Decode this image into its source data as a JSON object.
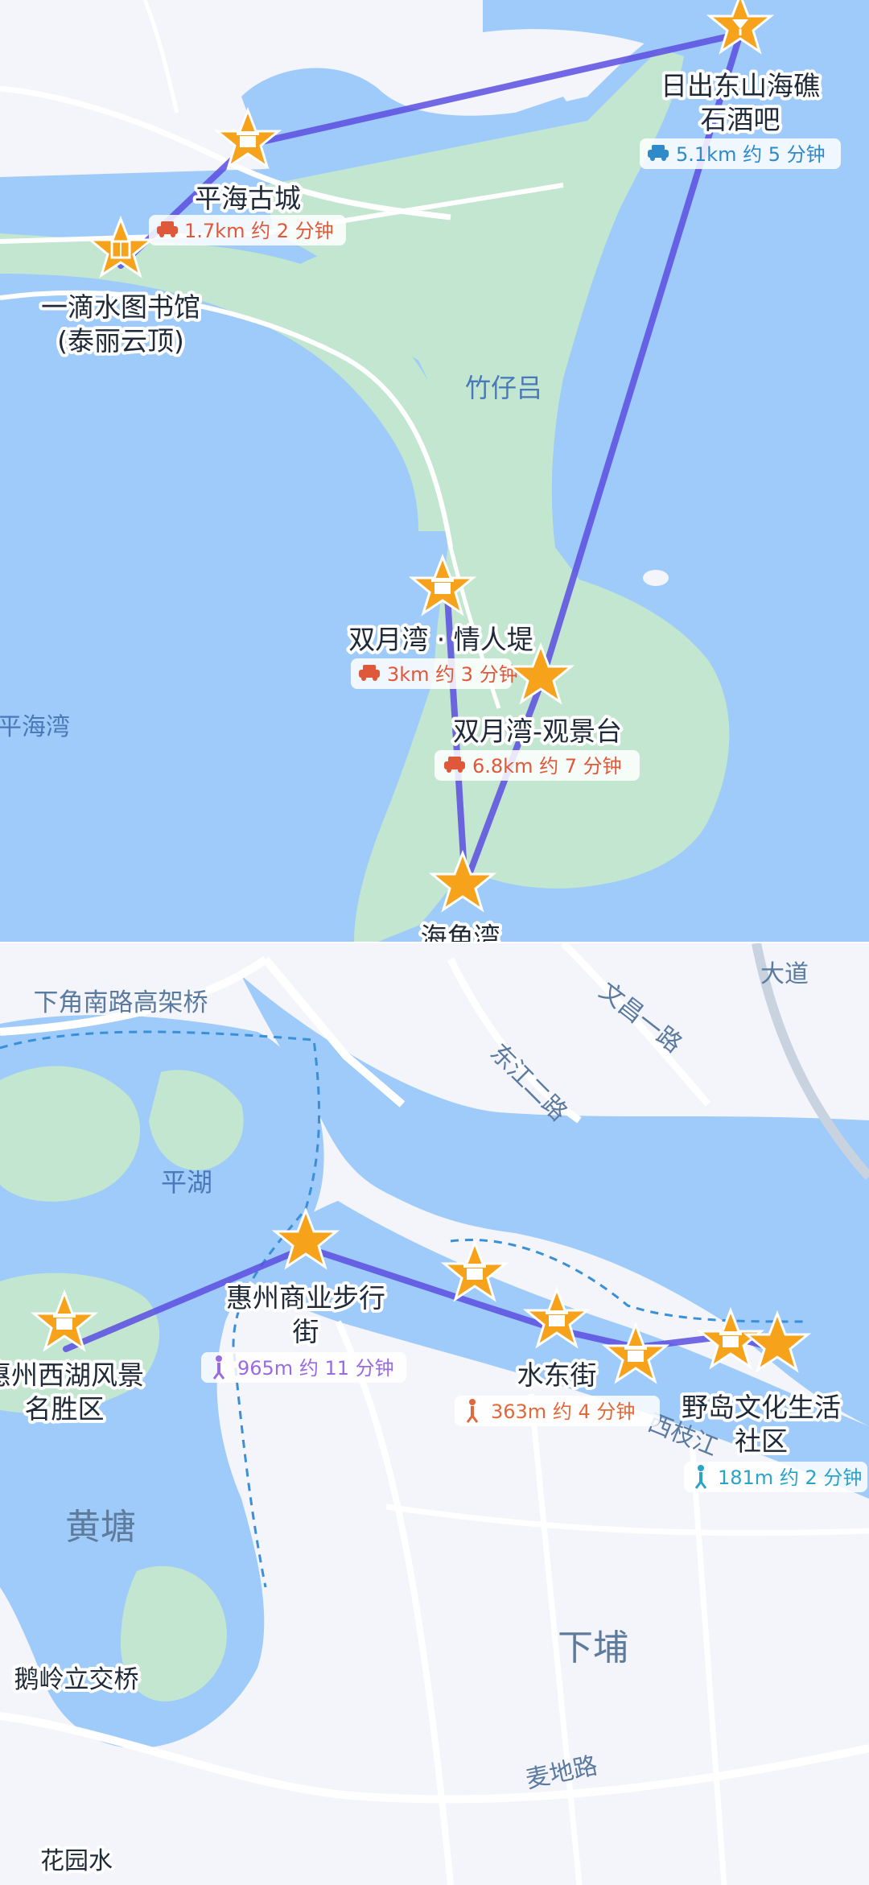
{
  "colors": {
    "water": "#9ecbf9",
    "land": "#f3f5fa",
    "green": "#c2e6cf",
    "road": "#ffffff",
    "route": "#6b5ee9",
    "poi_marker": "#f7a21b",
    "drive_color": "#e0583a",
    "walk_color_purple": "#9a6be0",
    "walk_color_orange": "#e0683a",
    "walk_color_blue": "#2aa3c9",
    "drive_color_blue": "#2f8ac9"
  },
  "top_map": {
    "stops": [
      {
        "name": "平海古城",
        "icon": "gate-icon"
      },
      {
        "name": "一滴水图书馆",
        "name2": "(泰丽云顶)",
        "icon": "book-icon"
      },
      {
        "name": "日出东山海礁",
        "name2": "石酒吧",
        "icon": "cocktail-icon"
      },
      {
        "name": "双月湾 · 情人堤",
        "icon": "gate-icon"
      },
      {
        "name": "双月湾-观景台",
        "icon": "star-icon"
      },
      {
        "name": "海角湾",
        "icon": "star-icon"
      }
    ],
    "legs": [
      {
        "mode": "drive",
        "icon": "car-icon",
        "text": "1.7km 约 2 分钟"
      },
      {
        "mode": "drive",
        "icon": "car-icon",
        "text": "5.1km 约 5 分钟"
      },
      {
        "mode": "drive",
        "icon": "car-icon",
        "text": "3km 约 3 分钟"
      },
      {
        "mode": "drive",
        "icon": "car-icon",
        "text": "6.8km 约 7 分钟"
      }
    ],
    "place_labels": [
      "竹仔吕",
      "平海湾"
    ]
  },
  "bottom_map": {
    "stops": [
      {
        "name": "惠州西湖风景",
        "name2": "名胜区",
        "icon": "gate-icon"
      },
      {
        "name": "惠州商业步行",
        "name2": "街",
        "icon": "star-icon"
      },
      {
        "name": "水东街",
        "icon": "gate-icon"
      },
      {
        "name": "野岛文化生活",
        "name2": "社区",
        "icon": "star-icon"
      }
    ],
    "legs": [
      {
        "mode": "walk",
        "icon": "walk-icon",
        "text": "965m 约 11 分钟"
      },
      {
        "mode": "walk",
        "icon": "walk-icon",
        "text": "363m 约 4 分钟"
      },
      {
        "mode": "walk",
        "icon": "walk-icon",
        "text": "181m 约 2 分钟"
      }
    ],
    "road_labels": [
      "下角南路高架桥",
      "文昌一路",
      "东江二路",
      "大道",
      "西枝江",
      "麦地路",
      "鹅岭立交桥"
    ],
    "place_labels": [
      "平湖",
      "黄塘",
      "下埔",
      "花园水"
    ]
  }
}
